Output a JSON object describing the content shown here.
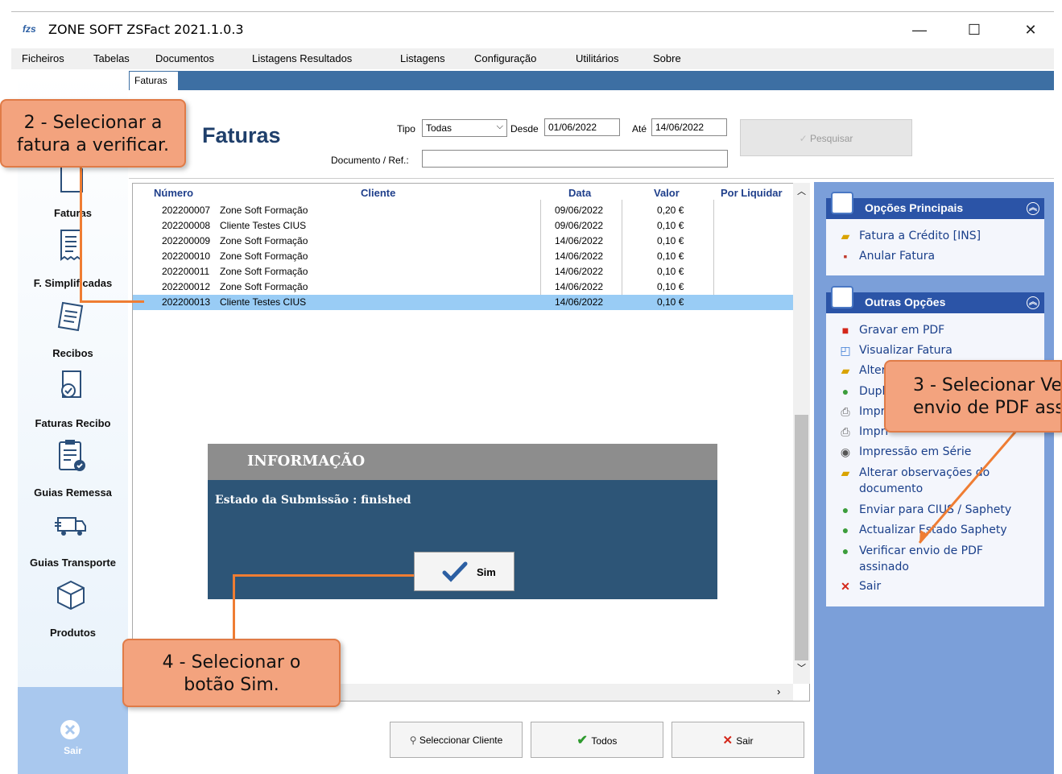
{
  "window": {
    "logo": "fzs",
    "title": "ZONE SOFT ZSFact 2021.1.0.3",
    "controls": {
      "minimize": "—",
      "maximize": "☐",
      "close": "✕"
    }
  },
  "menu": [
    "Ficheiros",
    "Tabelas",
    "Documentos",
    "Listagens Resultados",
    "Listagens",
    "Configuração",
    "Utilitários",
    "Sobre"
  ],
  "sidebar": {
    "items": [
      "Faturas",
      "F. Simplificadas",
      "Recibos",
      "Faturas Recibo",
      "Guias Remessa",
      "Guias Transporte",
      "Produtos"
    ],
    "exit_label": "Sair"
  },
  "tab": "Faturas",
  "page_title": "Faturas",
  "filters": {
    "tipo_label": "Tipo",
    "tipo_value": "Todas",
    "desde_label": "Desde",
    "desde_value": "01/06/2022",
    "ate_label": "Até",
    "ate_value": "14/06/2022",
    "doc_label": "Documento / Ref.:",
    "doc_value": "",
    "search_button": "Pesquisar"
  },
  "table": {
    "columns": [
      "Número",
      "Cliente",
      "Data",
      "Valor",
      "Por Liquidar"
    ],
    "rows": [
      {
        "numero": "202200007",
        "cliente": "Zone Soft Formação",
        "data": "09/06/2022",
        "valor": "0,20 €",
        "selected": false
      },
      {
        "numero": "202200008",
        "cliente": "Cliente Testes CIUS",
        "data": "09/06/2022",
        "valor": "0,10 €",
        "selected": false
      },
      {
        "numero": "202200009",
        "cliente": "Zone Soft Formação",
        "data": "14/06/2022",
        "valor": "0,10 €",
        "selected": false
      },
      {
        "numero": "202200010",
        "cliente": "Zone Soft Formação",
        "data": "14/06/2022",
        "valor": "0,10 €",
        "selected": false
      },
      {
        "numero": "202200011",
        "cliente": "Zone Soft Formação",
        "data": "14/06/2022",
        "valor": "0,10 €",
        "selected": false
      },
      {
        "numero": "202200012",
        "cliente": "Zone Soft Formação",
        "data": "14/06/2022",
        "valor": "0,10 €",
        "selected": false
      },
      {
        "numero": "202200013",
        "cliente": "Cliente Testes CIUS",
        "data": "14/06/2022",
        "valor": "0,10 €",
        "selected": true
      }
    ]
  },
  "panel_main": {
    "title": "Opções Principais",
    "options": [
      "Fatura a Crédito [INS]",
      "Anular Fatura"
    ]
  },
  "panel_other": {
    "title": "Outras Opções",
    "options": [
      "Gravar em PDF",
      "Visualizar Fatura",
      "Alter",
      "Dupl",
      "Impr",
      "Impri",
      "Impressão em Série",
      "Alterar observações do",
      "documento",
      "Enviar para CIUS / Saphety",
      "Actualizar Estado Saphety",
      "Verificar envio de PDF",
      "assinado",
      "Sair"
    ]
  },
  "bottom_buttons": [
    "Seleccionar Cliente",
    "Todos",
    "Sair"
  ],
  "dialog": {
    "title": "INFORMAÇÃO",
    "message": "Estado da Submissão : finished",
    "button": "Sim"
  },
  "callouts": {
    "c2_line1": "2 - Selecionar a",
    "c2_line2": "fatura a verificar.",
    "c3_line1": "3 - Selecionar Ve",
    "c3_line2": "envio de PDF ass",
    "c4_line1": "4 - Selecionar o",
    "c4_line2": "botão Sim."
  },
  "colors": {
    "accent": "#2b54a7",
    "selection": "#99ccf5",
    "dialog_bg": "#2d5577",
    "callout": "#f3a37e",
    "arrow": "#ef7d33"
  }
}
